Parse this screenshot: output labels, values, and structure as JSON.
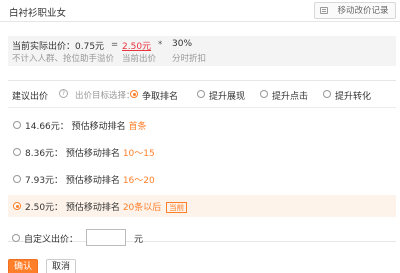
{
  "header": {
    "title": "白衬衫职业女",
    "history_button": "移动改价记录"
  },
  "summary": {
    "current_price_text": "当前实际出价：0.75元",
    "current_price_label": "不计入人群、抢位助手溢价",
    "equals": "=",
    "bid_price": "2.50元",
    "bid_label": "当前出价",
    "times": "*",
    "discount": "30%",
    "discount_label": "分时折扣"
  },
  "goal": {
    "label": "建议出价",
    "help_icon": "?",
    "hint": "出价目标选择：",
    "options": [
      "争取排名",
      "提升展现",
      "提升点击",
      "提升转化"
    ],
    "selected_index": 0
  },
  "suggestions": [
    {
      "price": "14.66元：",
      "desc": "预估移动排名",
      "rank": "首条",
      "badge": ""
    },
    {
      "price": "8.36元：",
      "desc": "预估移动排名",
      "rank": "10～15",
      "badge": ""
    },
    {
      "price": "7.93元：",
      "desc": "预估移动排名",
      "rank": "16～20",
      "badge": ""
    },
    {
      "price": "2.50元：",
      "desc": "预估移动排名",
      "rank": "20条以后",
      "badge": "当前"
    }
  ],
  "selected_suggestion": 3,
  "custom": {
    "label": "自定义出价：",
    "value": "",
    "unit": "元"
  },
  "actions": {
    "ok": "确认",
    "cancel": "取消"
  },
  "colors": {
    "accent": "#ff7f2a",
    "price_red": "#e8323c",
    "selected_bg": "#fdf3ea"
  }
}
